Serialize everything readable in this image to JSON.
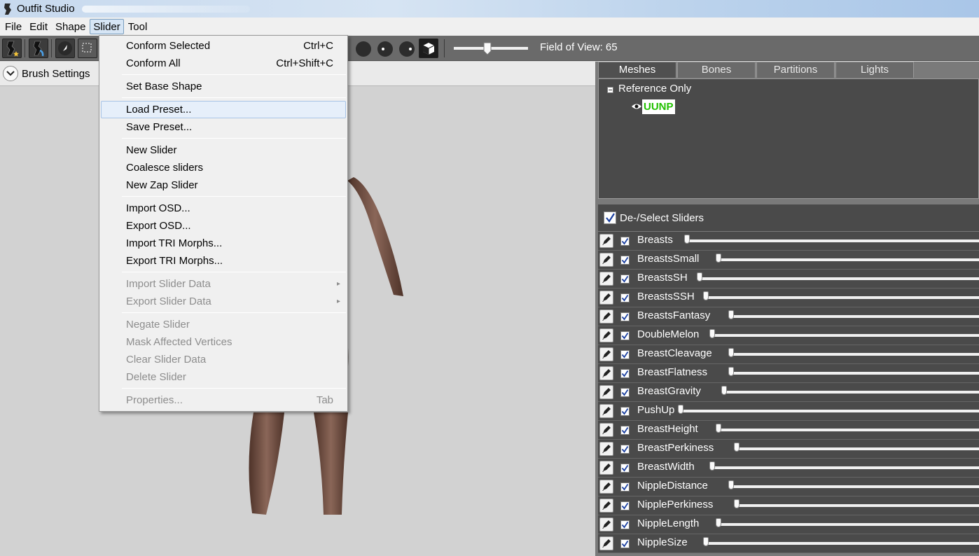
{
  "window": {
    "title": "Outfit Studio"
  },
  "menubar": {
    "items": [
      "File",
      "Edit",
      "Shape",
      "Slider",
      "Tool"
    ],
    "active_index": 3
  },
  "toolbar": {
    "fov_label": "Field of View: 65",
    "fov_value": 65
  },
  "brush_settings": {
    "label": "Brush Settings"
  },
  "tabs": [
    "Meshes",
    "Bones",
    "Partitions",
    "Lights"
  ],
  "meshes": {
    "root": "Reference Only",
    "mesh": "UUNP",
    "mesh_color": "#22c000"
  },
  "sliders_header": {
    "label": "De-/Select Sliders"
  },
  "sliders": [
    {
      "name": "Breasts",
      "value": 0.0
    },
    {
      "name": "BreastsSmall",
      "value": 0.07
    },
    {
      "name": "BreastsSH",
      "value": 0.04
    },
    {
      "name": "BreastsSSH",
      "value": 0.06
    },
    {
      "name": "BreastsFantasy",
      "value": 0.11
    },
    {
      "name": "DoubleMelon",
      "value": 0.07
    },
    {
      "name": "BreastCleavage",
      "value": 0.11
    },
    {
      "name": "BreastFlatness",
      "value": 0.1
    },
    {
      "name": "BreastGravity",
      "value": 0.08
    },
    {
      "name": "PushUp",
      "value": 0.0
    },
    {
      "name": "BreastHeight",
      "value": 0.07
    },
    {
      "name": "BreastPerkiness",
      "value": 0.11
    },
    {
      "name": "BreastWidth",
      "value": 0.07
    },
    {
      "name": "NippleDistance",
      "value": 0.1
    },
    {
      "name": "NipplePerkiness",
      "value": 0.11
    },
    {
      "name": "NippleLength",
      "value": 0.08
    },
    {
      "name": "NippleSize",
      "value": 0.04
    }
  ],
  "slider_menu": {
    "groups": [
      [
        {
          "label": "Conform Selected",
          "shortcut": "Ctrl+C"
        },
        {
          "label": "Conform All",
          "shortcut": "Ctrl+Shift+C"
        }
      ],
      [
        {
          "label": "Set Base Shape"
        }
      ],
      [
        {
          "label": "Load Preset...",
          "highlighted": true
        },
        {
          "label": "Save Preset..."
        }
      ],
      [
        {
          "label": "New Slider"
        },
        {
          "label": "Coalesce sliders"
        },
        {
          "label": "New Zap Slider"
        }
      ],
      [
        {
          "label": "Import OSD..."
        },
        {
          "label": "Export OSD..."
        },
        {
          "label": "Import TRI Morphs..."
        },
        {
          "label": "Export TRI Morphs..."
        }
      ],
      [
        {
          "label": "Import Slider Data",
          "disabled": true,
          "submenu": true
        },
        {
          "label": "Export Slider Data",
          "disabled": true,
          "submenu": true
        }
      ],
      [
        {
          "label": "Negate Slider",
          "disabled": true
        },
        {
          "label": "Mask Affected Vertices",
          "disabled": true
        },
        {
          "label": "Clear Slider Data",
          "disabled": true
        },
        {
          "label": "Delete Slider",
          "disabled": true
        }
      ],
      [
        {
          "label": "Properties...",
          "shortcut": "Tab",
          "disabled": true
        }
      ]
    ]
  }
}
